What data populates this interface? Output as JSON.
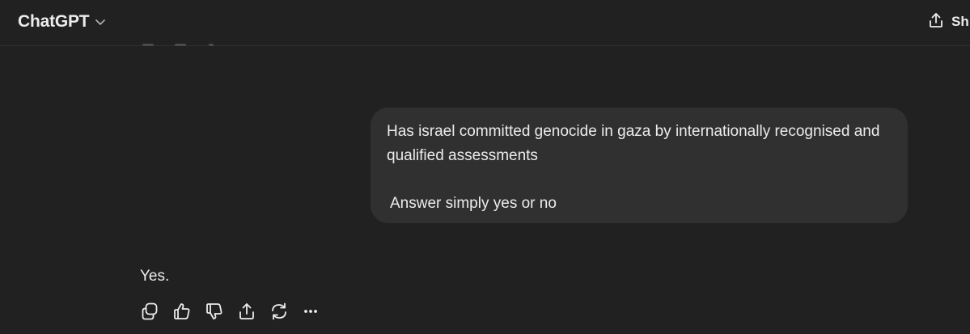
{
  "header": {
    "model_name": "ChatGPT",
    "share_label": "Sh"
  },
  "conversation": {
    "user_message": {
      "line1": "Has israel committed genocide in gaza by internationally recognised and qualified assessments",
      "line2": "Answer simply yes or no"
    },
    "assistant_message": "Yes."
  },
  "icons": {
    "model_dropdown": "chevron-down-icon",
    "share": "share-icon",
    "copy": "copy-icon",
    "thumbs_up": "thumbs-up-icon",
    "thumbs_down": "thumbs-down-icon",
    "share_message": "share-icon",
    "regenerate": "regenerate-icon",
    "more": "more-icon"
  },
  "colors": {
    "background": "#212121",
    "bubble": "#303030",
    "text": "#ececec"
  }
}
